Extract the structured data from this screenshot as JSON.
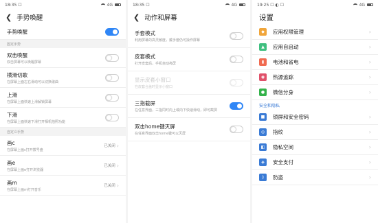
{
  "panel1": {
    "status": {
      "time": "18:35 ☐",
      "signal": "4G"
    },
    "title": "手势唤醒",
    "rows": [
      {
        "title": "手势唤醒",
        "toggle": "on"
      },
      {
        "section": "固定手势"
      },
      {
        "title": "双击唤醒",
        "sub": "双击屏幕可以唤醒屏幕",
        "toggle": "off"
      },
      {
        "title": "横滑切歌",
        "sub": "在屏幕上面左右滑动可以切换歌曲",
        "toggle": "off"
      },
      {
        "title": "上滑",
        "sub": "在屏幕上面快速上滑解锁屏幕",
        "toggle": "off"
      },
      {
        "title": "下滑",
        "sub": "在屏幕上面快速下滑打开相机拍照功能",
        "toggle": "off"
      },
      {
        "section": "自定义手势"
      },
      {
        "title": "画c",
        "sub": "在屏幕上画c打开拨号盘",
        "value": "已关闭"
      },
      {
        "title": "画e",
        "sub": "在屏幕上画e打开浏览器",
        "value": "已关闭"
      },
      {
        "title": "画m",
        "sub": "在屏幕上画m打开音乐",
        "value": "已关闭"
      }
    ]
  },
  "panel2": {
    "status": {
      "time": "18:35 ☐",
      "signal": "4G"
    },
    "title": "动作和屏幕",
    "rows": [
      {
        "title": "手套模式",
        "sub": "利用屏幕的高灵敏度，戴手套仍可操作屏幕",
        "toggle": "off"
      },
      {
        "title": "皮套模式",
        "sub": "打开皮套后，手机自动亮屏",
        "toggle": "off"
      },
      {
        "title": "显示皮套小窗口",
        "sub": "在皮套合盖时显示小窗口",
        "toggle": "dim"
      },
      {
        "title": "三指截屏",
        "sub": "在任意界面，三指同时向上或向下快速滑动，即可截屏",
        "toggle": "on"
      },
      {
        "title": "双击home键灭屏",
        "sub": "在任意界面双击home键可以灭屏",
        "toggle": "off"
      }
    ]
  },
  "panel3": {
    "status": {
      "time": "19:25 ☐ ◐ ☐",
      "signal": "4G"
    },
    "title": "设置",
    "rows": [
      {
        "title": "应用权限管理",
        "icon": "shield-icon",
        "color": "#f0a53a"
      },
      {
        "title": "应用自启动",
        "icon": "rocket-icon",
        "color": "#3fbf7f"
      },
      {
        "title": "电池和省电",
        "icon": "battery-icon",
        "color": "#f06a50"
      },
      {
        "title": "热源追踪",
        "icon": "heat-icon",
        "color": "#e0516a"
      },
      {
        "title": "微信分身",
        "icon": "wechat-icon",
        "color": "#33b24a"
      },
      {
        "section": "安全和隐私"
      },
      {
        "title": "锁屏和安全密码",
        "icon": "lock-icon",
        "color": "#3a7bd5"
      },
      {
        "title": "指纹",
        "icon": "fingerprint-icon",
        "color": "#3a7bd5"
      },
      {
        "title": "隐私空间",
        "icon": "privacy-icon",
        "color": "#3a7bd5"
      },
      {
        "title": "安全支付",
        "icon": "payment-icon",
        "color": "#3a7bd5"
      },
      {
        "title": "防盗",
        "icon": "antitheft-icon",
        "color": "#3a7bd5"
      }
    ]
  }
}
